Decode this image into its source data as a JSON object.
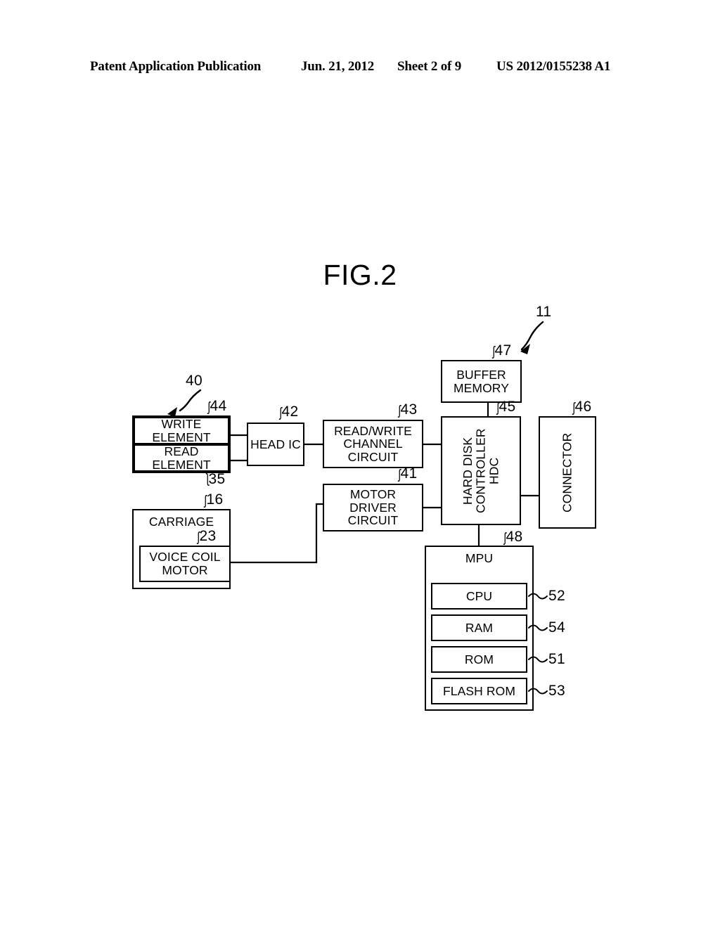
{
  "header": {
    "publication": "Patent Application Publication",
    "date": "Jun. 21, 2012",
    "sheet": "Sheet 2 of 9",
    "number": "US 2012/0155238 A1"
  },
  "figure": {
    "title": "FIG.2",
    "system_ref": "11"
  },
  "blocks": {
    "head_assembly": {
      "label": "",
      "ref": "40"
    },
    "write_element": {
      "label": "WRITE\nELEMENT",
      "ref": "44"
    },
    "read_element": {
      "label": "READ\nELEMENT",
      "ref": "35"
    },
    "head_ic": {
      "label": "HEAD IC",
      "ref": "42"
    },
    "read_write_channel": {
      "label": "READ/WRITE\nCHANNEL\nCIRCUIT",
      "ref": "43"
    },
    "buffer_memory": {
      "label": "BUFFER\nMEMORY",
      "ref": "47"
    },
    "hdc": {
      "label": "HARD DISK\nCONTROLLER\nHDC",
      "ref": "45"
    },
    "connector": {
      "label": "CONNECTOR",
      "ref": "46"
    },
    "motor_driver": {
      "label": "MOTOR\nDRIVER\nCIRCUIT",
      "ref": "41"
    },
    "carriage": {
      "label": "CARRIAGE",
      "ref": "16"
    },
    "voice_coil_motor": {
      "label": "VOICE COIL\nMOTOR",
      "ref": "23"
    },
    "mpu": {
      "label": "MPU",
      "ref": "48"
    },
    "cpu": {
      "label": "CPU",
      "ref": "52"
    },
    "ram": {
      "label": "RAM",
      "ref": "54"
    },
    "rom": {
      "label": "ROM",
      "ref": "51"
    },
    "flash_rom": {
      "label": "FLASH ROM",
      "ref": "53"
    }
  },
  "leader_glyph": "ʃ"
}
